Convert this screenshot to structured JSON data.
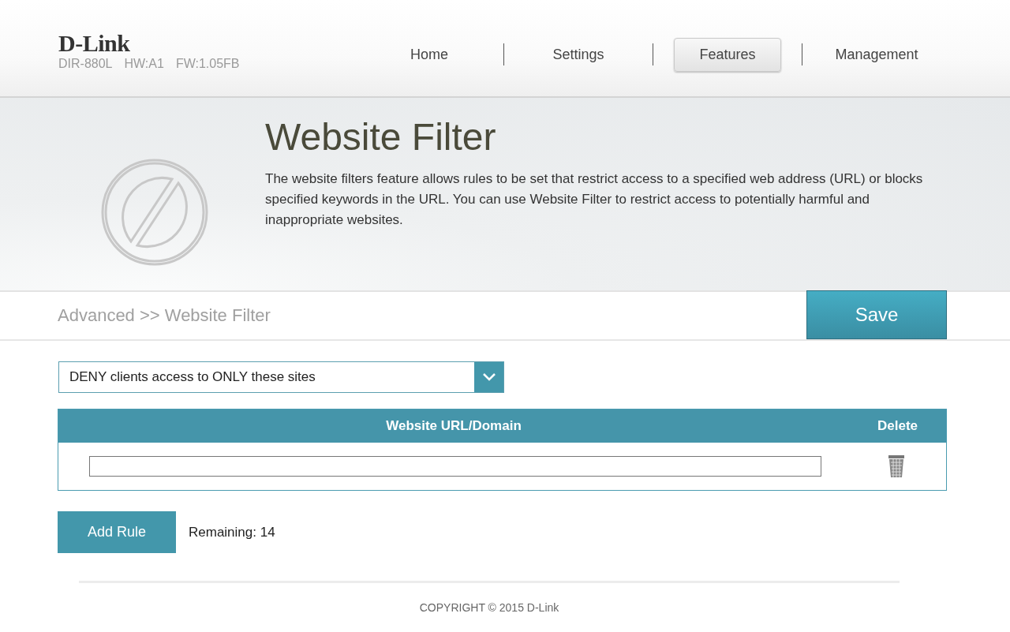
{
  "header": {
    "logo": "D-Link",
    "model": "DIR-880L",
    "hardware": "HW:A1",
    "firmware": "FW:1.05FB"
  },
  "nav": [
    {
      "label": "Home",
      "selected": false
    },
    {
      "label": "Settings",
      "selected": false
    },
    {
      "label": "Features",
      "selected": true
    },
    {
      "label": "Management",
      "selected": false
    }
  ],
  "banner": {
    "title": "Website Filter",
    "description": "The website filters feature allows rules to be set that restrict access to a specified web address (URL) or blocks specified keywords in the URL. You can use Website Filter to restrict access to potentially harmful and inappropriate websites."
  },
  "breadcrumb": "Advanced >> Website Filter",
  "save_button": "Save",
  "filter_mode": {
    "value": "DENY clients access to ONLY these sites"
  },
  "table": {
    "columns": [
      "Website URL/Domain",
      "Delete"
    ],
    "rows": [
      {
        "url": ""
      }
    ]
  },
  "add_rule_button": "Add Rule",
  "remaining": "Remaining: 14",
  "footer": "COPYRIGHT © 2015 D-Link"
}
